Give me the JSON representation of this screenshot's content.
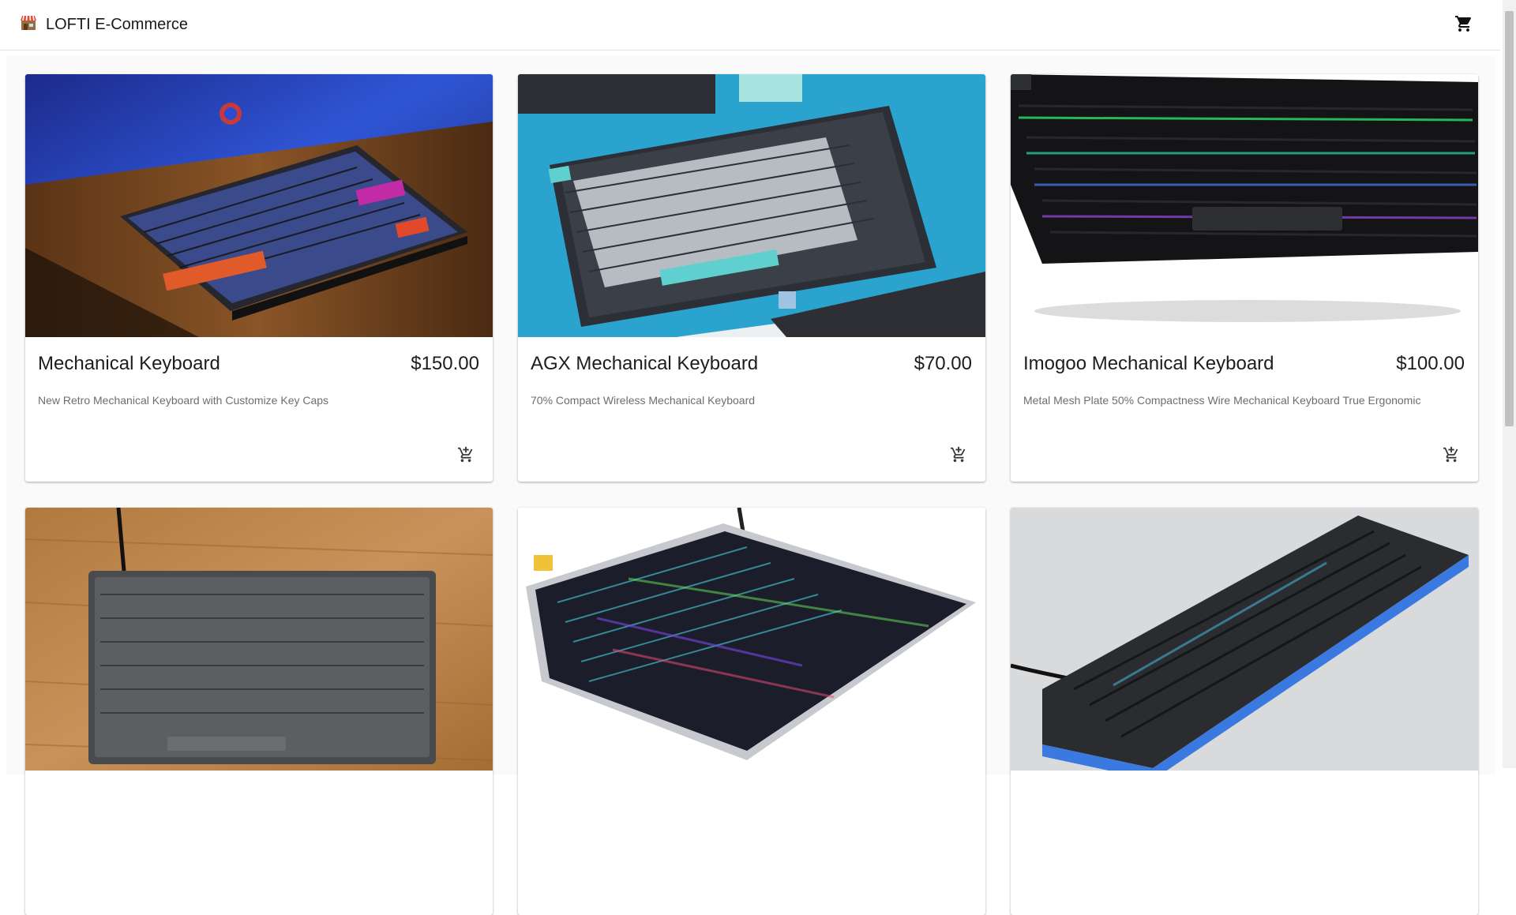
{
  "header": {
    "title": "LOFTI E-Commerce",
    "brand_icon": "store-icon",
    "cart_icon": "shopping-cart-icon"
  },
  "products": [
    {
      "name": "Mechanical Keyboard",
      "price": "$150.00",
      "description": "New Retro Mechanical Keyboard with Customize Key Caps"
    },
    {
      "name": "AGX Mechanical Keyboard",
      "price": "$70.00",
      "description": "70% Compact Wireless Mechanical Keyboard"
    },
    {
      "name": "Imogoo Mechanical Keyboard",
      "price": "$100.00",
      "description": "Metal Mesh Plate 50% Compactness Wire Mechanical Keyboard True Ergonomic"
    },
    {
      "name": "",
      "price": "",
      "description": ""
    },
    {
      "name": "",
      "price": "",
      "description": ""
    },
    {
      "name": "",
      "price": "",
      "description": ""
    }
  ],
  "icons": {
    "add_to_cart": "add-shopping-cart-icon"
  },
  "colors": {
    "background": "#fafafa",
    "card": "#ffffff",
    "text": "#1d1d1d",
    "muted": "#6e6e6e"
  }
}
